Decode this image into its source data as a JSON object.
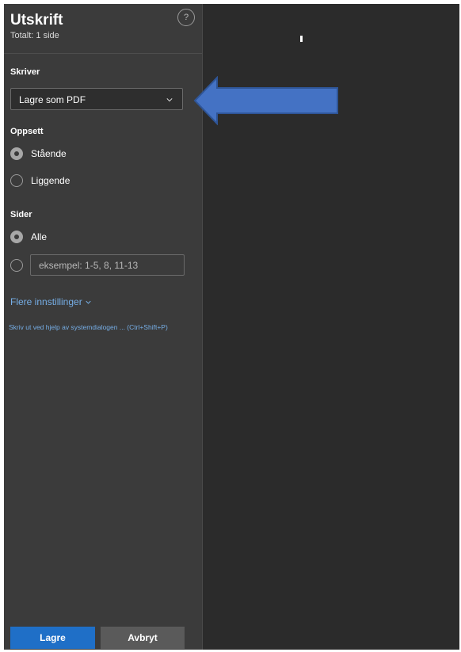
{
  "panel": {
    "title": "Utskrift",
    "subtitle": "Totalt: 1 side",
    "help_label": "?"
  },
  "printer": {
    "label": "Skriver",
    "selected": "Lagre som PDF"
  },
  "layout": {
    "label": "Oppsett",
    "options": [
      "Stående",
      "Liggende"
    ],
    "selected_index": 0
  },
  "pages": {
    "label": "Sider",
    "all_label": "Alle",
    "range_placeholder": "eksempel: 1-5, 8, 11-13"
  },
  "more_settings_label": "Flere innstillinger",
  "system_dialog_label": "Skriv ut ved hjelp av systemdialogen ... (Ctrl+Shift+P)",
  "buttons": {
    "save": "Lagre",
    "cancel": "Avbryt"
  },
  "colors": {
    "accent": "#1f6fc7",
    "link": "#76aee6",
    "annotation_arrow": "#4472c4"
  }
}
